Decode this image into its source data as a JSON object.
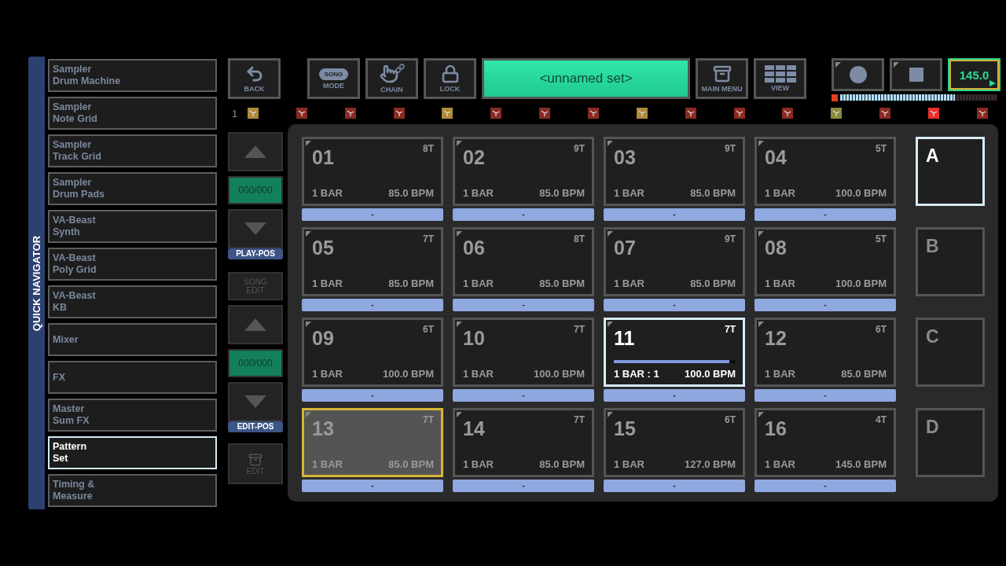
{
  "sidebar": {
    "title": "QUICK NAVIGATOR",
    "items": [
      {
        "lines": [
          "Sampler",
          "Drum Machine"
        ],
        "selected": false
      },
      {
        "lines": [
          "Sampler",
          "Note Grid"
        ],
        "selected": false
      },
      {
        "lines": [
          "Sampler",
          "Track Grid"
        ],
        "selected": false
      },
      {
        "lines": [
          "Sampler",
          "Drum Pads"
        ],
        "selected": false
      },
      {
        "lines": [
          "VA-Beast",
          "Synth"
        ],
        "selected": false
      },
      {
        "lines": [
          "VA-Beast",
          "Poly Grid"
        ],
        "selected": false
      },
      {
        "lines": [
          "VA-Beast",
          "KB"
        ],
        "selected": false
      },
      {
        "lines": [
          "Mixer"
        ],
        "selected": false
      },
      {
        "lines": [
          "FX"
        ],
        "selected": false
      },
      {
        "lines": [
          "Master",
          "Sum FX"
        ],
        "selected": false
      },
      {
        "lines": [
          "Pattern",
          "Set"
        ],
        "selected": true
      },
      {
        "lines": [
          "Timing &",
          "Measure"
        ],
        "selected": false
      }
    ]
  },
  "toolbar": [
    {
      "kind": "back",
      "label": "BACK"
    },
    {
      "kind": "mode",
      "label": "MODE",
      "badge": "SONG"
    },
    {
      "kind": "chain",
      "label": "CHAIN"
    },
    {
      "kind": "lock",
      "label": "LOCK"
    },
    {
      "kind": "set_name",
      "label": "<unnamed set>"
    },
    {
      "kind": "main_menu",
      "label": "MAIN MENU"
    },
    {
      "kind": "view",
      "label": "VIEW"
    }
  ],
  "transport": {
    "tempo": "145.0",
    "meter": {
      "level": 0.73
    }
  },
  "track_row": {
    "label": "1",
    "tracks": [
      {
        "color": "#b08a3a"
      },
      {
        "color": "#8a2a22"
      },
      {
        "color": "#8a2a22"
      },
      {
        "color": "#8a2a22"
      },
      {
        "color": "#b08a3a"
      },
      {
        "color": "#8a2a22"
      },
      {
        "color": "#8a2a22"
      },
      {
        "color": "#8a2a22"
      },
      {
        "color": "#b08a3a"
      },
      {
        "color": "#8a2a22"
      },
      {
        "color": "#8a2a22"
      },
      {
        "color": "#8a2a22"
      },
      {
        "color": "#8a8a3a"
      },
      {
        "color": "#8a2a22"
      },
      {
        "color": "#e8302a"
      },
      {
        "color": "#8a2a22"
      }
    ]
  },
  "position": [
    {
      "counter": "000/000",
      "tag": "PLAY-POS"
    },
    {
      "counter": "000/000",
      "tag": "EDIT-POS"
    }
  ],
  "song_edit": {
    "label": "SONG\nEDIT",
    "disabled": true
  },
  "edit": {
    "label": "EDIT",
    "disabled": true
  },
  "patterns": [
    {
      "number": "01",
      "tracks": "8T",
      "bars": "1 BAR",
      "bpm": "85.0 BPM",
      "playing": false,
      "selected": false,
      "footer": "-"
    },
    {
      "number": "02",
      "tracks": "9T",
      "bars": "1 BAR",
      "bpm": "85.0 BPM",
      "playing": false,
      "selected": false,
      "footer": "-"
    },
    {
      "number": "03",
      "tracks": "9T",
      "bars": "1 BAR",
      "bpm": "85.0 BPM",
      "playing": false,
      "selected": false,
      "footer": "-"
    },
    {
      "number": "04",
      "tracks": "5T",
      "bars": "1 BAR",
      "bpm": "100.0 BPM",
      "playing": false,
      "selected": false,
      "footer": "-"
    },
    {
      "number": "05",
      "tracks": "7T",
      "bars": "1 BAR",
      "bpm": "85.0 BPM",
      "playing": false,
      "selected": false,
      "footer": "-"
    },
    {
      "number": "06",
      "tracks": "8T",
      "bars": "1 BAR",
      "bpm": "85.0 BPM",
      "playing": false,
      "selected": false,
      "footer": "-"
    },
    {
      "number": "07",
      "tracks": "9T",
      "bars": "1 BAR",
      "bpm": "85.0 BPM",
      "playing": false,
      "selected": false,
      "footer": "-"
    },
    {
      "number": "08",
      "tracks": "5T",
      "bars": "1 BAR",
      "bpm": "100.0 BPM",
      "playing": false,
      "selected": false,
      "footer": "-"
    },
    {
      "number": "09",
      "tracks": "6T",
      "bars": "1 BAR",
      "bpm": "100.0 BPM",
      "playing": false,
      "selected": false,
      "footer": "-"
    },
    {
      "number": "10",
      "tracks": "7T",
      "bars": "1 BAR",
      "bpm": "100.0 BPM",
      "playing": false,
      "selected": false,
      "footer": "-"
    },
    {
      "number": "11",
      "tracks": "7T",
      "bars": "1 BAR : 1",
      "bpm": "100.0 BPM",
      "playing": true,
      "level": 0.95,
      "selected": false,
      "footer": "-"
    },
    {
      "number": "12",
      "tracks": "6T",
      "bars": "1 BAR",
      "bpm": "85.0 BPM",
      "playing": false,
      "selected": false,
      "footer": "-"
    },
    {
      "number": "13",
      "tracks": "7T",
      "bars": "1 BAR",
      "bpm": "85.0 BPM",
      "playing": false,
      "selected": true,
      "footer": "-"
    },
    {
      "number": "14",
      "tracks": "7T",
      "bars": "1 BAR",
      "bpm": "85.0 BPM",
      "playing": false,
      "selected": false,
      "footer": "-"
    },
    {
      "number": "15",
      "tracks": "6T",
      "bars": "1 BAR",
      "bpm": "127.0 BPM",
      "playing": false,
      "selected": false,
      "footer": "-"
    },
    {
      "number": "16",
      "tracks": "4T",
      "bars": "1 BAR",
      "bpm": "145.0 BPM",
      "playing": false,
      "selected": false,
      "footer": "-"
    }
  ],
  "scenes": [
    {
      "label": "A",
      "selected": true
    },
    {
      "label": "B",
      "selected": false
    },
    {
      "label": "C",
      "selected": false
    },
    {
      "label": "D",
      "selected": false
    }
  ]
}
